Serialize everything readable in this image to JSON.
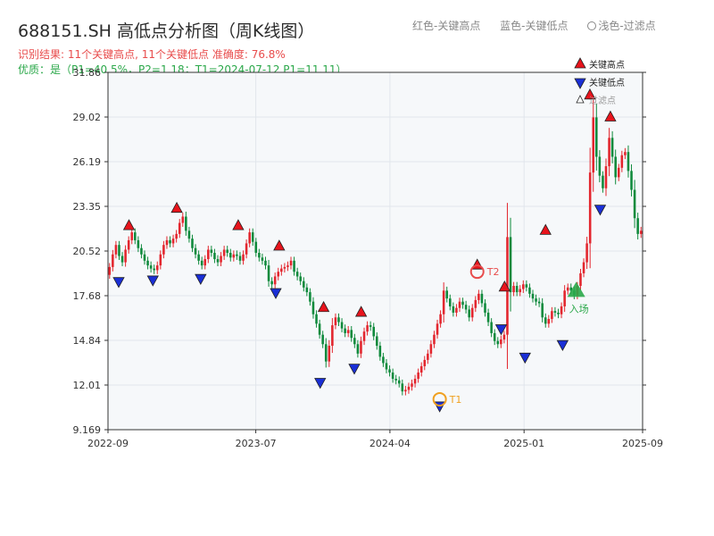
{
  "header": {
    "title": "688151.SH 高低点分析图（周K线图）",
    "legend_red": "红色-关键高点",
    "legend_blue": "蓝色-关键低点",
    "legend_filtered": "浅色-过滤点",
    "result": "识别结果: 11个关键高点, 11个关键低点   准确度: 76.8%",
    "quality": "优质：是（P1=40.5%，P2=1.18；T1=2024-07-12 P1=11.11）"
  },
  "chart_data": {
    "type": "candlestick",
    "title": "688151.SH 高低点分析图（周K线图）",
    "ylim": [
      9.169,
      31.86
    ],
    "y_ticks": [
      "9.169",
      "12.01",
      "14.84",
      "17.68",
      "20.52",
      "23.35",
      "26.19",
      "29.02",
      "31.86"
    ],
    "x_ticks": [
      "2022-09",
      "2023-07",
      "2024-04",
      "2025-01",
      "2025-09"
    ],
    "x_start": "2022-09",
    "x_end": "2025-09",
    "series": [
      {
        "name": "周K线",
        "closes": [
          19.5,
          20.3,
          20.9,
          20.2,
          19.8,
          20.6,
          21.2,
          21.7,
          21.2,
          20.7,
          20.3,
          19.9,
          19.6,
          19.4,
          19.3,
          19.6,
          20.3,
          20.9,
          21.2,
          21.0,
          21.3,
          21.6,
          22.3,
          22.7,
          21.8,
          21.3,
          20.7,
          20.3,
          19.9,
          19.6,
          20.0,
          20.6,
          20.4,
          20.0,
          19.8,
          20.2,
          20.6,
          20.4,
          20.1,
          20.3,
          20.2,
          19.9,
          20.3,
          21.0,
          21.7,
          21.1,
          20.4,
          20.1,
          19.9,
          19.6,
          18.6,
          18.4,
          18.9,
          19.2,
          19.4,
          19.5,
          19.6,
          19.9,
          19.2,
          18.9,
          18.6,
          18.2,
          17.9,
          17.3,
          16.5,
          15.9,
          15.2,
          14.6,
          13.5,
          14.5,
          15.8,
          16.3,
          16.0,
          15.6,
          15.3,
          15.5,
          15.0,
          14.6,
          14.0,
          14.8,
          15.4,
          15.8,
          15.7,
          15.1,
          14.5,
          13.8,
          13.4,
          13.0,
          12.8,
          12.4,
          12.3,
          12.1,
          11.6,
          11.7,
          11.9,
          12.1,
          12.4,
          12.8,
          13.2,
          13.6,
          14.0,
          14.6,
          15.2,
          15.9,
          16.5,
          18.0,
          17.5,
          17.0,
          16.6,
          16.9,
          17.3,
          17.1,
          16.8,
          16.3,
          16.9,
          17.4,
          17.8,
          17.2,
          16.6,
          16.0,
          15.3,
          14.8,
          14.6,
          14.9,
          15.2,
          21.4,
          17.9,
          18.3,
          17.9,
          18.1,
          18.4,
          18.2,
          17.8,
          17.5,
          17.3,
          17.2,
          16.3,
          15.9,
          16.2,
          16.7,
          16.6,
          16.5,
          17.0,
          18.0,
          18.2,
          18.0,
          17.7,
          18.3,
          19.1,
          19.8,
          21.0,
          25.5,
          29.0,
          26.5,
          25.3,
          24.5,
          25.9,
          27.7,
          26.5,
          25.2,
          25.8,
          26.6,
          26.8,
          25.6,
          24.4,
          22.6,
          21.6,
          21.8
        ]
      }
    ],
    "key_highs": [
      {
        "date": "2022-10-14",
        "price": 21.7
      },
      {
        "date": "2023-01-20",
        "price": 22.8
      },
      {
        "date": "2023-05-26",
        "price": 21.7
      },
      {
        "date": "2023-08-18",
        "price": 20.4
      },
      {
        "date": "2023-11-17",
        "price": 16.5
      },
      {
        "date": "2024-02-02",
        "price": 16.2
      },
      {
        "date": "2024-09-27",
        "price": 19.2
      },
      {
        "date": "2024-11-22",
        "price": 17.8
      },
      {
        "date": "2025-02-14",
        "price": 21.4
      },
      {
        "date": "2025-05-16",
        "price": 30.0
      },
      {
        "date": "2025-06-27",
        "price": 28.6
      }
    ],
    "key_lows": [
      {
        "date": "2022-09-23",
        "price": 19.0
      },
      {
        "date": "2022-12-02",
        "price": 19.1
      },
      {
        "date": "2023-03-10",
        "price": 19.2
      },
      {
        "date": "2023-08-11",
        "price": 18.3
      },
      {
        "date": "2023-11-10",
        "price": 12.6
      },
      {
        "date": "2024-01-19",
        "price": 13.5
      },
      {
        "date": "2024-07-12",
        "price": 11.1
      },
      {
        "date": "2024-11-15",
        "price": 16.0
      },
      {
        "date": "2025-01-03",
        "price": 14.2
      },
      {
        "date": "2025-03-21",
        "price": 15.0
      },
      {
        "date": "2025-06-06",
        "price": 23.6
      }
    ],
    "markers": [
      {
        "label": "T1",
        "date": "2024-07-12",
        "price": 11.1
      },
      {
        "label": "T2",
        "date": "2024-09-27",
        "price": 19.2
      },
      {
        "label": "入场",
        "date": "2025-04-18",
        "price": 18.0
      }
    ],
    "legend": {
      "position": "top-right",
      "items": [
        "关键高点",
        "关键低点",
        "过滤点"
      ]
    },
    "colors": {
      "up": "#e3262e",
      "down": "#0f8a3c",
      "high_marker": "#e8141c",
      "low_marker": "#1a2fd6",
      "t1_marker": "#f0a020",
      "t2_marker": "#e84c4c",
      "entry_marker": "#2ba84a",
      "plot_background": "#f6f8fa",
      "grid": "#e1e6ec"
    },
    "grid": true
  }
}
